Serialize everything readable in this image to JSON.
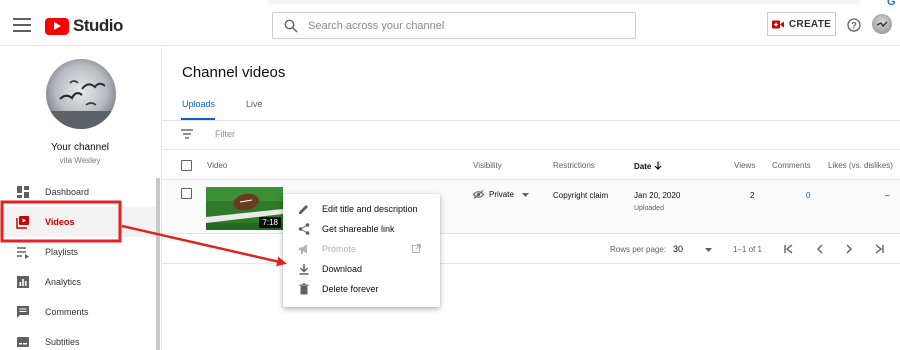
{
  "app": {
    "name": "Studio"
  },
  "search": {
    "placeholder": "Search across your channel"
  },
  "header": {
    "create_label": "CREATE"
  },
  "channel": {
    "title": "Your channel",
    "name": "vita Wesley"
  },
  "sidebar": {
    "items": [
      {
        "label": "Dashboard",
        "icon": "dashboard-icon",
        "active": false
      },
      {
        "label": "Videos",
        "icon": "videos-icon",
        "active": true
      },
      {
        "label": "Playlists",
        "icon": "playlists-icon",
        "active": false
      },
      {
        "label": "Analytics",
        "icon": "analytics-icon",
        "active": false
      },
      {
        "label": "Comments",
        "icon": "comments-icon",
        "active": false
      },
      {
        "label": "Subtitles",
        "icon": "subtitles-icon",
        "active": false
      }
    ]
  },
  "main": {
    "title": "Channel videos",
    "tabs": [
      {
        "label": "Uploads",
        "active": true
      },
      {
        "label": "Live",
        "active": false
      }
    ],
    "filter_placeholder": "Filter",
    "columns": {
      "video": "Video",
      "visibility": "Visibility",
      "restrictions": "Restrictions",
      "date": "Date",
      "views": "Views",
      "comments": "Comments",
      "likes": "Likes (vs. dislikes)"
    },
    "rows": [
      {
        "duration": "7:18",
        "visibility": "Private",
        "restrictions": "Copyright claim",
        "date": "Jan 20, 2020",
        "date_status": "Uploaded",
        "views": "2",
        "comments": "0",
        "likes": "–"
      }
    ],
    "pager": {
      "rows_label": "Rows per page:",
      "rows_value": "30",
      "range": "1–1 of 1"
    }
  },
  "menu": {
    "items": [
      {
        "label": "Edit title and description",
        "icon": "pencil-icon",
        "disabled": false
      },
      {
        "label": "Get shareable link",
        "icon": "share-icon",
        "disabled": false
      },
      {
        "label": "Promote",
        "icon": "megaphone-icon",
        "disabled": true
      },
      {
        "label": "Download",
        "icon": "download-icon",
        "disabled": false
      },
      {
        "label": "Delete forever",
        "icon": "trash-icon",
        "disabled": false
      }
    ]
  },
  "colors": {
    "accent": "#065fd4",
    "brand": "#ff0000",
    "annotation": "#e32222"
  }
}
